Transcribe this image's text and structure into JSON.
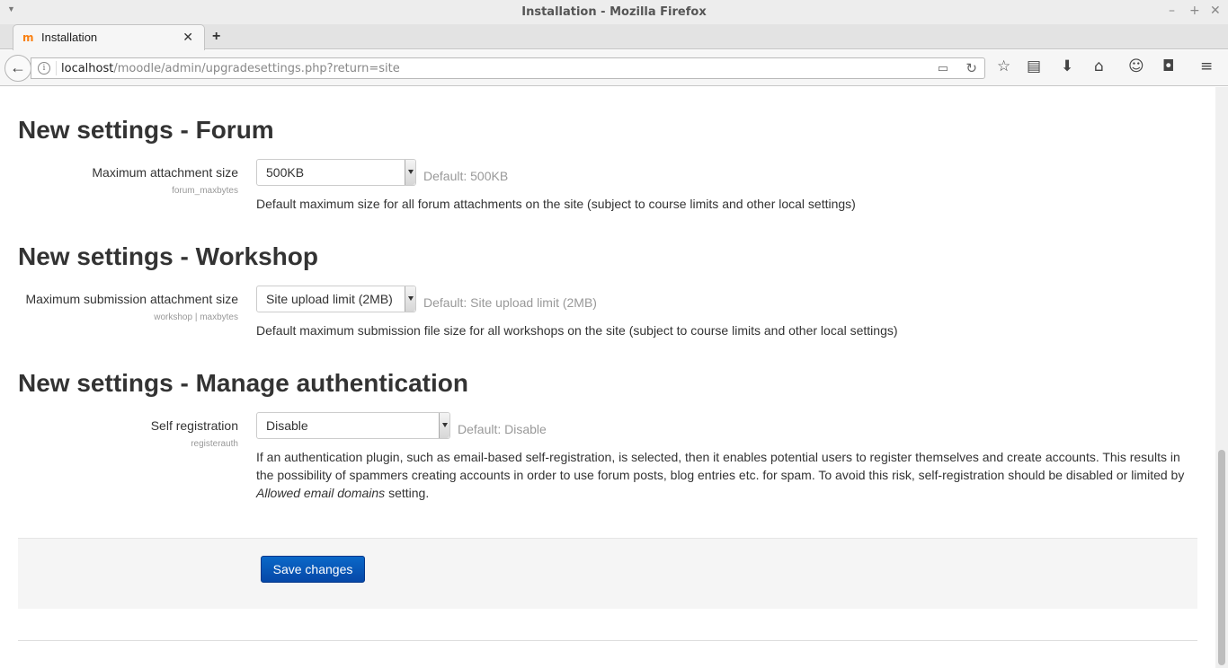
{
  "window": {
    "title": "Installation - Mozilla Firefox",
    "minimize": "–",
    "maximize": "+",
    "close": "✕"
  },
  "tab": {
    "label": "Installation",
    "close": "✕",
    "new_tab": "+"
  },
  "navbar": {
    "url_host": "localhost",
    "url_path": "/moodle/admin/upgradesettings.php?return=site"
  },
  "sections": [
    {
      "heading": "New settings - Forum",
      "label": "Maximum attachment size",
      "sublabel": "forum_maxbytes",
      "selected": "500KB",
      "default": "Default: 500KB",
      "description": "Default maximum size for all forum attachments on the site (subject to course limits and other local settings)"
    },
    {
      "heading": "New settings - Workshop",
      "label": "Maximum submission attachment size",
      "sublabel": "workshop | maxbytes",
      "selected": "Site upload limit (2MB)",
      "default": "Default: Site upload limit (2MB)",
      "description": "Default maximum submission file size for all workshops on the site (subject to course limits and other local settings)"
    },
    {
      "heading": "New settings - Manage authentication",
      "label": "Self registration",
      "sublabel": "registerauth",
      "selected": "Disable",
      "default": "Default: Disable",
      "description_pre": "If an authentication plugin, such as email-based self-registration, is selected, then it enables potential users to register themselves and create accounts. This results in the possibility of spammers creating accounts in order to use forum posts, blog entries etc. for spam. To avoid this risk, self-registration should be disabled or limited by ",
      "description_em": "Allowed email domains",
      "description_post": " setting."
    }
  ],
  "save_label": "Save changes",
  "colors": {
    "primary_button": "#0a5cbf",
    "brand_favicon": "#f98012"
  }
}
